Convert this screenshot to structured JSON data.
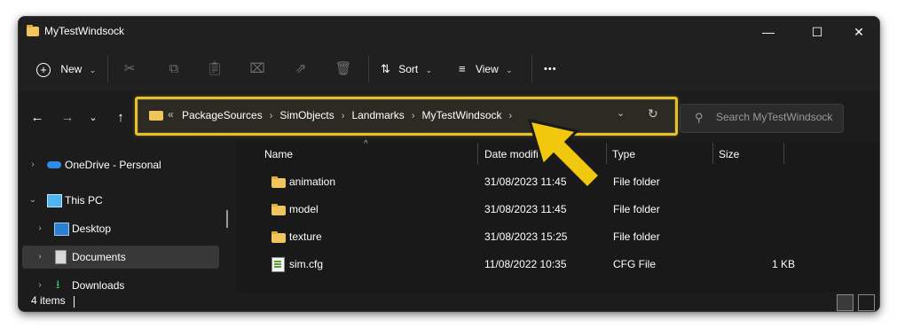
{
  "window": {
    "title": "MyTestWindsock"
  },
  "toolbar": {
    "new_label": "New",
    "sort_label": "Sort",
    "view_label": "View",
    "more_label": "•••"
  },
  "address": {
    "overflow": "«",
    "crumbs": [
      "PackageSources",
      "SimObjects",
      "Landmarks",
      "MyTestWindsock"
    ],
    "separator": "›"
  },
  "search": {
    "placeholder": "Search MyTestWindsock"
  },
  "sidebar": {
    "items": [
      {
        "label": "OneDrive - Personal",
        "icon": "cloud-icon"
      },
      {
        "label": "This PC",
        "icon": "computer-icon"
      },
      {
        "label": "Desktop",
        "icon": "desktop-icon"
      },
      {
        "label": "Documents",
        "icon": "documents-icon",
        "selected": true
      },
      {
        "label": "Downloads",
        "icon": "download-icon"
      }
    ]
  },
  "columns": {
    "name": "Name",
    "date": "Date modified",
    "type": "Type",
    "size": "Size"
  },
  "files": [
    {
      "name": "animation",
      "date": "31/08/2023 11:45",
      "type": "File folder",
      "size": "",
      "icon": "folder-icon"
    },
    {
      "name": "model",
      "date": "31/08/2023 11:45",
      "type": "File folder",
      "size": "",
      "icon": "folder-icon"
    },
    {
      "name": "texture",
      "date": "31/08/2023 15:25",
      "type": "File folder",
      "size": "",
      "icon": "folder-icon"
    },
    {
      "name": "sim.cfg",
      "date": "11/08/2022 10:35",
      "type": "CFG File",
      "size": "1 KB",
      "icon": "cfg-file-icon"
    }
  ],
  "status": {
    "items_count": "4 items"
  },
  "colors": {
    "highlight": "#e6c02a",
    "arrow": "#f2c80f",
    "folder": "#f2c55c",
    "background": "#1c1c1c"
  }
}
